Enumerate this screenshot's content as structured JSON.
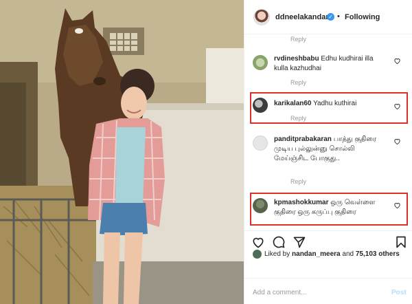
{
  "header": {
    "username": "ddneelakandan",
    "separator": "•",
    "follow_label": "Following"
  },
  "comments": [
    {
      "user": "",
      "text": "",
      "reply": "Reply"
    },
    {
      "user": "rvdineshbabu",
      "text": "Edhu kudhirai illa kulla kazhudhai",
      "reply": "Reply"
    },
    {
      "user": "karikalan60",
      "text": "Yadhu kuthirai",
      "reply": "Reply"
    },
    {
      "user": "panditprabakaran",
      "text": "பாத்து குதிரை முடிய புல்லுன்னு சொல்லி மேய்ஞ்சிட போகுது..",
      "reply": "Reply"
    },
    {
      "user": "kpmashokkumar",
      "text": "ஒரு வெள்ளை குதிரை ஒரு கருப்பு குதிரை",
      "reply": ""
    }
  ],
  "likes": {
    "prefix": "Liked by",
    "user": "nandan_meera",
    "middle": "and",
    "count": "75,103 others"
  },
  "add_comment": {
    "placeholder": "Add a comment...",
    "post_label": "Post"
  },
  "icons": [
    "verified-badge-icon",
    "heart-icon",
    "comment-icon",
    "share-icon",
    "bookmark-icon"
  ],
  "colors": {
    "highlight": "#d9302c",
    "verified": "#3897f0",
    "post": "#b2dffc"
  }
}
